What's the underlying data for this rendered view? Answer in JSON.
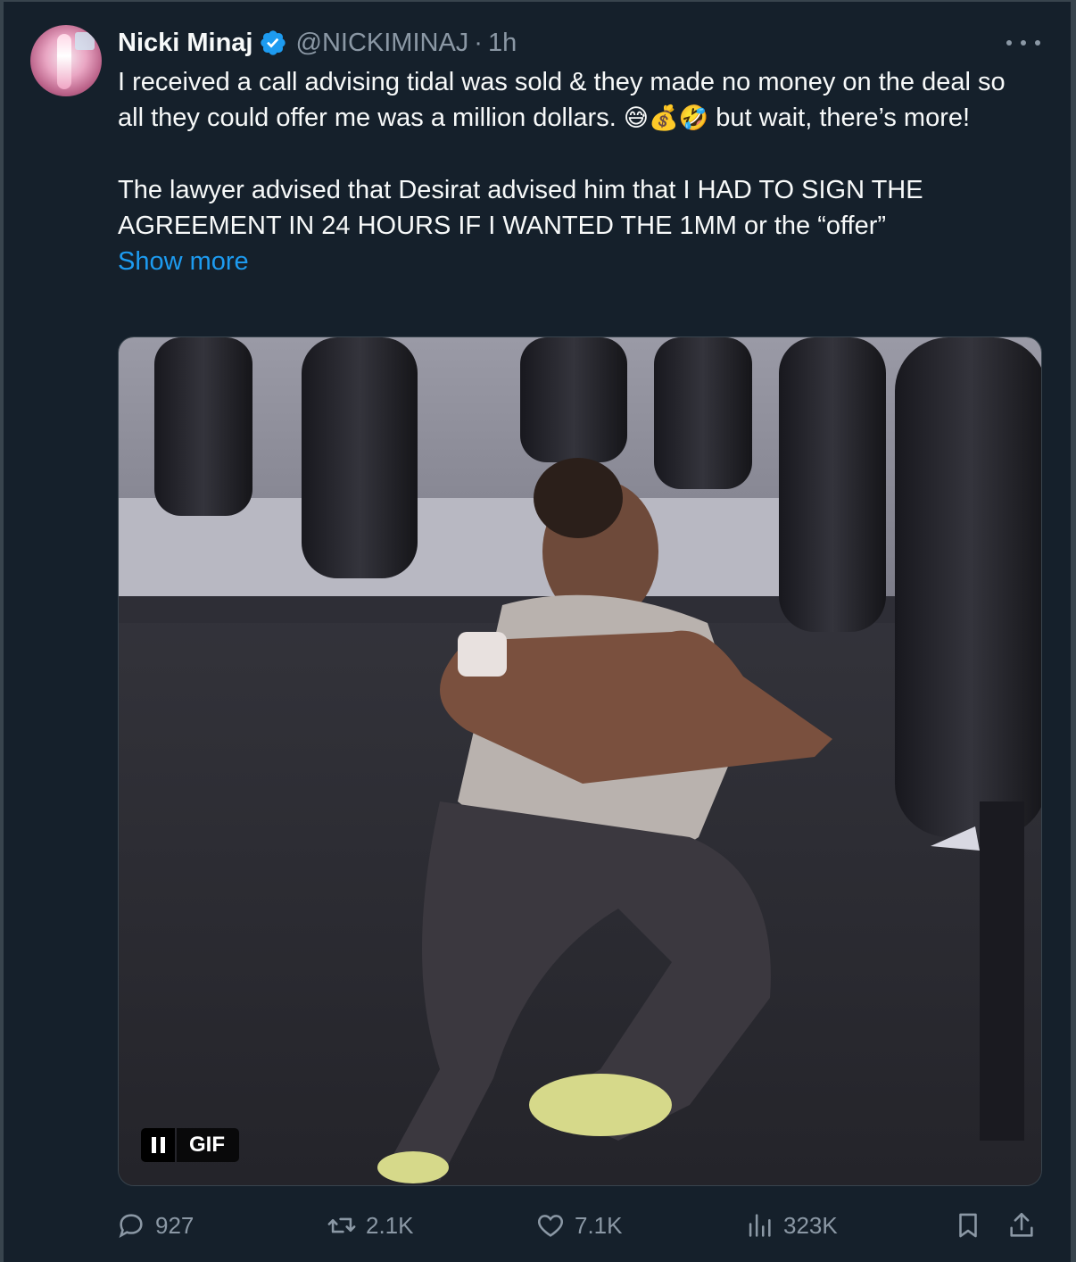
{
  "tweet": {
    "author_name": "Nicki Minaj",
    "handle": "@NICKIMINAJ",
    "separator": "·",
    "time": "1h",
    "text_line1": "I received a call advising tidal was sold & they made no money on the deal so all they could offer me was a million dollars.",
    "emojis": "😅💰🤣",
    "text_line1b": " but wait, there’s more!",
    "text_para2": "The lawyer advised that Desirat advised him that I HAD TO SIGN THE AGREEMENT IN 24 HOURS IF I WANTED THE 1MM or the “offer”",
    "show_more": "Show more"
  },
  "media": {
    "badge": "GIF"
  },
  "actions": {
    "replies": "927",
    "reposts": "2.1K",
    "likes": "7.1K",
    "views": "323K"
  },
  "colors": {
    "background": "#15202b",
    "accent": "#1d9bf0",
    "secondary_text": "#8b98a5"
  }
}
